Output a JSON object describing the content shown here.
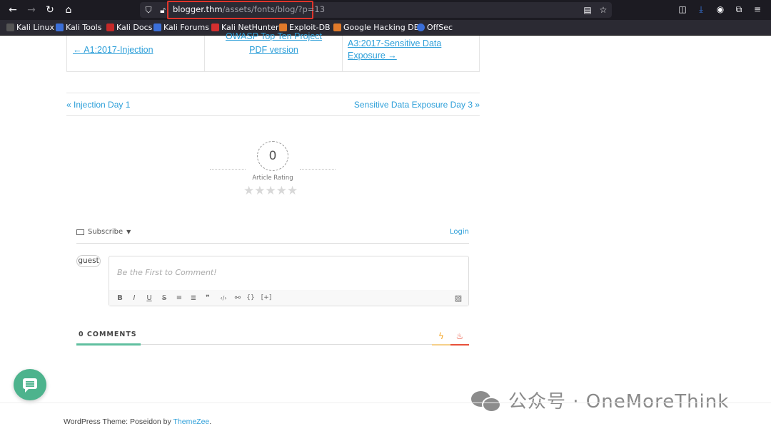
{
  "browser": {
    "url_host": "blogger.thm",
    "url_path": "/assets/fonts/blog/?p=13",
    "bookmarks": [
      {
        "label": "Kali Linux",
        "color": "#1d1d1d"
      },
      {
        "label": "Kali Tools",
        "color": "#3b6fd8"
      },
      {
        "label": "Kali Docs",
        "color": "#c62828"
      },
      {
        "label": "Kali Forums",
        "color": "#3b6fd8"
      },
      {
        "label": "Kali NetHunter",
        "color": "#d32f2f"
      },
      {
        "label": "Exploit-DB",
        "color": "#e07a2a"
      },
      {
        "label": "Google Hacking DB",
        "color": "#e07a2a"
      },
      {
        "label": "OffSec",
        "color": "#3b6fd8"
      }
    ]
  },
  "owasp_nav": {
    "prev_label": "← A1:2017-Injection",
    "center_line1": "OWASP Top Ten Project",
    "center_line2": "PDF version",
    "next_line1": "A3:2017-Sensitive Data",
    "next_line2": "Exposure →"
  },
  "post_nav": {
    "prev": "« Injection Day 1",
    "next": "Sensitive Data Exposure Day 3 »"
  },
  "rating": {
    "value": "0",
    "label": "Article Rating",
    "stars": "★★★★★",
    "stars_filled": 0,
    "stars_total": 5
  },
  "comments": {
    "subscribe_label": "Subscribe",
    "login_label": "Login",
    "avatar_label": "guest",
    "placeholder": "Be the First to Comment!",
    "toolbar": [
      "B",
      "I",
      "U",
      "S",
      "≡",
      "≣",
      "❞",
      "‹/›",
      "⚯",
      "{}",
      "[+]"
    ],
    "count_label": "0 COMMENTS"
  },
  "watermark": "公众号 · OneMoreThink",
  "footer": {
    "prefix": "WordPress Theme: Poseidon by ",
    "link": "ThemeZee",
    "suffix": "."
  },
  "colors": {
    "link": "#2d9fd9",
    "accent_green": "#5fbf9f",
    "chat_button": "#4db38d",
    "url_highlight": "#e0342a"
  }
}
